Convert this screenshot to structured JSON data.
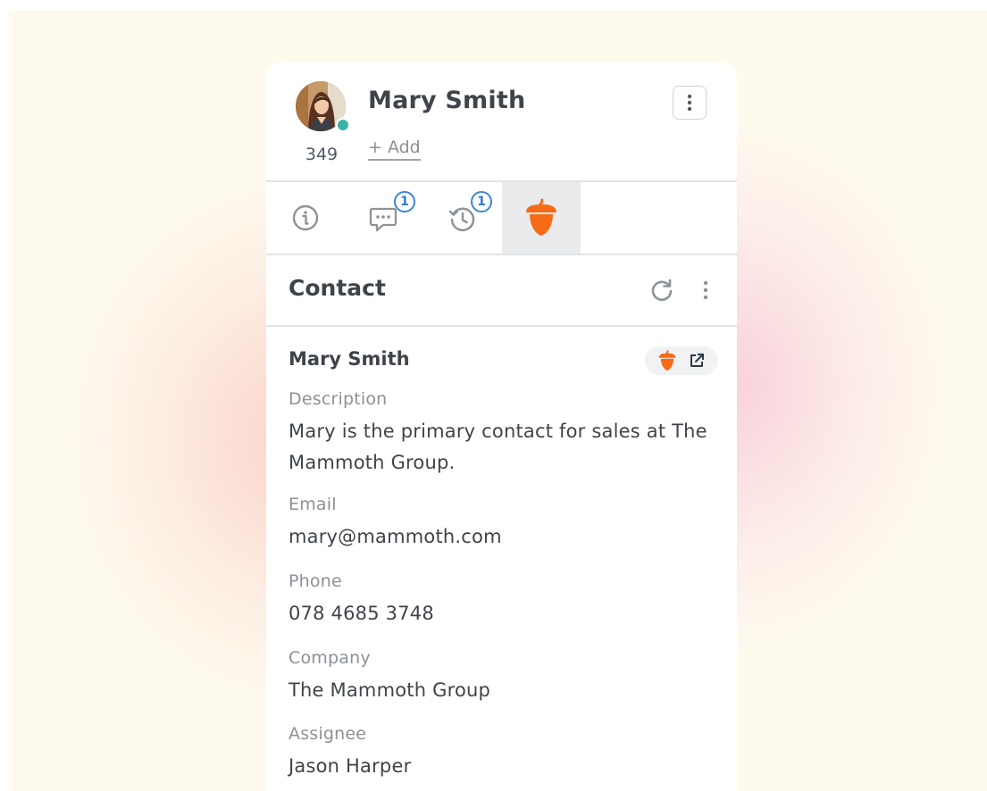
{
  "header": {
    "contact_name": "Mary Smith",
    "contact_count": "349",
    "add_label": "+ Add",
    "presence_color": "#3ab2a6"
  },
  "tabs": [
    {
      "icon": "info-icon",
      "badge": ""
    },
    {
      "icon": "chat-icon",
      "badge": "1"
    },
    {
      "icon": "history-icon",
      "badge": "1"
    },
    {
      "icon": "acorn-icon",
      "badge": "",
      "active": true
    }
  ],
  "section": {
    "title": "Contact"
  },
  "record": {
    "name": "Mary Smith",
    "fields": [
      {
        "label": "Description",
        "value": "Mary is the primary contact for sales at The Mammoth Group."
      },
      {
        "label": "Email",
        "value": "mary@mammoth.com"
      },
      {
        "label": "Phone",
        "value": "078 4685 3748"
      },
      {
        "label": "Company",
        "value": "The Mammoth Group"
      },
      {
        "label": "Assignee",
        "value": "Jason Harper"
      }
    ]
  },
  "colors": {
    "accent_orange": "#f56b18",
    "badge_blue": "#3d86d8",
    "background": "#fefaee"
  }
}
